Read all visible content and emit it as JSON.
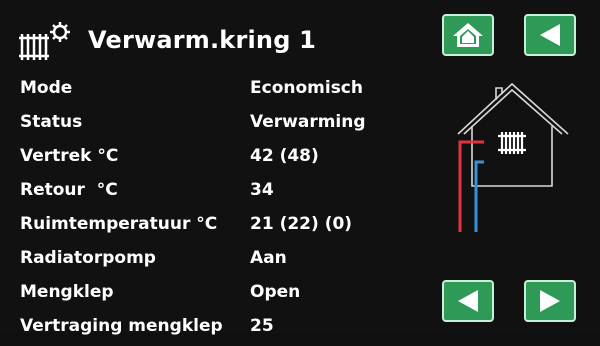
{
  "header": {
    "title": "Verwarm.kring 1",
    "icon": "radiator-gear-icon"
  },
  "buttons": {
    "home": "home-icon",
    "back": "back-arrow-icon",
    "prev": "prev-arrow-icon",
    "next": "next-arrow-icon"
  },
  "rows": [
    {
      "label": "Mode",
      "value": "Economisch"
    },
    {
      "label": "Status",
      "value": "Verwarming"
    },
    {
      "label": "Vertrek °C",
      "value": "42 (48)"
    },
    {
      "label": "Retour  °C",
      "value": "34"
    },
    {
      "label": "Ruimtemperatuur °C",
      "value": "21 (22) (0)"
    },
    {
      "label": "Radiatorpomp",
      "value": "Aan"
    },
    {
      "label": "Mengklep",
      "value": "Open"
    },
    {
      "label": "Vertraging mengklep",
      "value": "25"
    }
  ],
  "colors": {
    "button_green": "#2f9a57",
    "supply_pipe": "#e0353f",
    "return_pipe": "#3a8fd6"
  }
}
